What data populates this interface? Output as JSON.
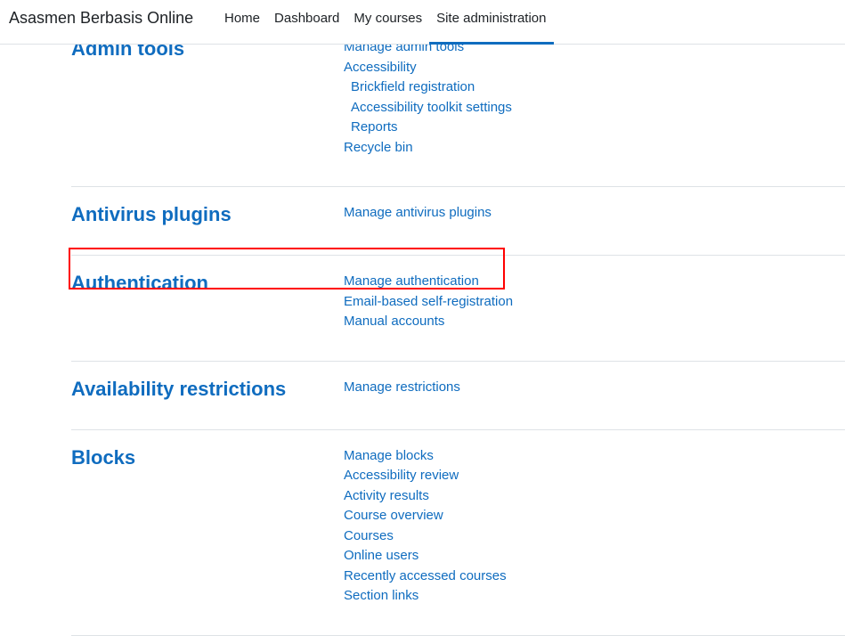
{
  "header": {
    "brand": "Asasmen Berbasis Online",
    "nav": [
      "Home",
      "Dashboard",
      "My courses",
      "Site administration"
    ],
    "active": "Site administration"
  },
  "sections": [
    {
      "title": "Admin tools",
      "links": [
        {
          "label": "Manage admin tools"
        },
        {
          "label": "Accessibility"
        },
        {
          "label": "Brickfield registration",
          "indent": true
        },
        {
          "label": "Accessibility toolkit settings",
          "indent": true
        },
        {
          "label": "Reports",
          "indent": true
        },
        {
          "label": "Recycle bin"
        }
      ]
    },
    {
      "title": "Antivirus plugins",
      "links": [
        {
          "label": "Manage antivirus plugins"
        }
      ]
    },
    {
      "title": "Authentication",
      "links": [
        {
          "label": "Manage authentication"
        },
        {
          "label": "Email-based self-registration"
        },
        {
          "label": "Manual accounts"
        }
      ]
    },
    {
      "title": "Availability restrictions",
      "links": [
        {
          "label": "Manage restrictions"
        }
      ]
    },
    {
      "title": "Blocks",
      "links": [
        {
          "label": "Manage blocks"
        },
        {
          "label": "Accessibility review"
        },
        {
          "label": "Activity results"
        },
        {
          "label": "Course overview"
        },
        {
          "label": "Courses"
        },
        {
          "label": "Online users"
        },
        {
          "label": "Recently accessed courses"
        },
        {
          "label": "Section links"
        }
      ]
    }
  ],
  "colors": {
    "accent": "#0f6cbf",
    "highlight": "#ff0000"
  }
}
